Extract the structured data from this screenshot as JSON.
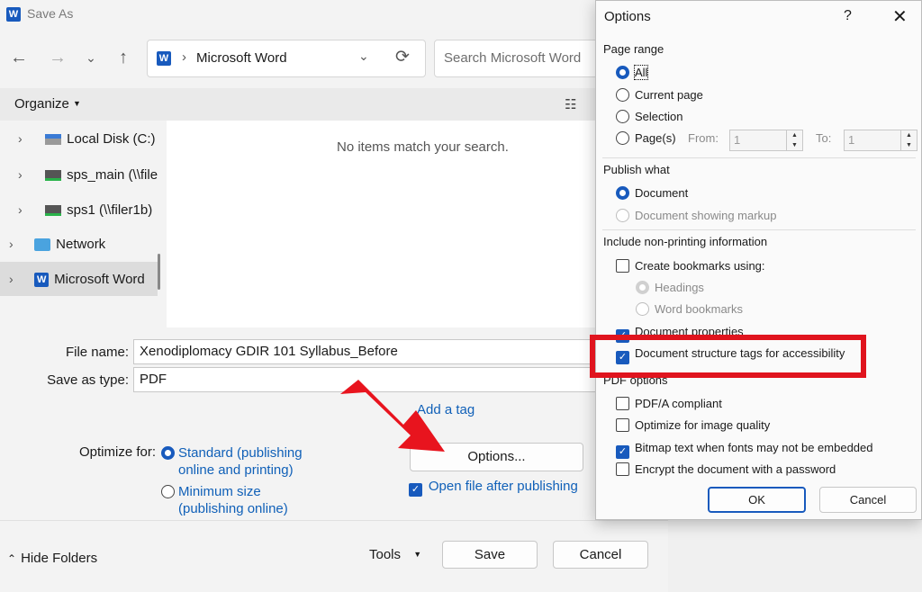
{
  "window": {
    "title": "Save As",
    "app_icon_letter": "W"
  },
  "address": {
    "location": "Microsoft Word"
  },
  "search": {
    "placeholder": "Search Microsoft Word"
  },
  "toolbar": {
    "organize_label": "Organize"
  },
  "tree": {
    "items": [
      {
        "label": "Local Disk (C:)"
      },
      {
        "label": "sps_main (\\\\filer"
      },
      {
        "label": "sps1 (\\\\filer1b)"
      },
      {
        "label": "Network"
      },
      {
        "label": "Microsoft Word"
      }
    ]
  },
  "content": {
    "empty_message": "No items match your search."
  },
  "form": {
    "file_name_label": "File name:",
    "file_name_value": "Xenodiplomacy GDIR 101 Syllabus_Before",
    "save_type_label": "Save as type:",
    "save_type_value": "PDF",
    "add_tag_label": "Add a tag",
    "optimize_label": "Optimize for:",
    "optimize_standard_line1": "Standard (publishing",
    "optimize_standard_line2": "online and printing)",
    "optimize_minimum_line1": "Minimum size",
    "optimize_minimum_line2": "(publishing online)",
    "options_button": "Options...",
    "open_after_label": "Open file after publishing"
  },
  "footer": {
    "hide_folders": "Hide Folders",
    "tools": "Tools",
    "save": "Save",
    "cancel": "Cancel"
  },
  "options": {
    "title": "Options",
    "help": "?",
    "page_range": {
      "heading": "Page range",
      "all": "All",
      "current_page": "Current page",
      "selection": "Selection",
      "pages": "Page(s)",
      "from_label": "From:",
      "from_value": "1",
      "to_label": "To:",
      "to_value": "1"
    },
    "publish_what": {
      "heading": "Publish what",
      "document": "Document",
      "document_markup": "Document showing markup"
    },
    "nonprinting": {
      "heading": "Include non-printing information",
      "create_bookmarks": "Create bookmarks using:",
      "headings": "Headings",
      "word_bookmarks": "Word bookmarks",
      "document_properties": "Document properties",
      "structure_tags": "Document structure tags for accessibility"
    },
    "pdf_options": {
      "heading": "PDF options",
      "pdfa": "PDF/A compliant",
      "optimize_image": "Optimize for image quality",
      "bitmap_text": "Bitmap text when fonts may not be embedded",
      "encrypt": "Encrypt the document with a password"
    },
    "ok": "OK",
    "cancel": "Cancel"
  },
  "colors": {
    "accent": "#185abd",
    "highlight_box": "#e0141e",
    "arrow": "#e8141e"
  }
}
